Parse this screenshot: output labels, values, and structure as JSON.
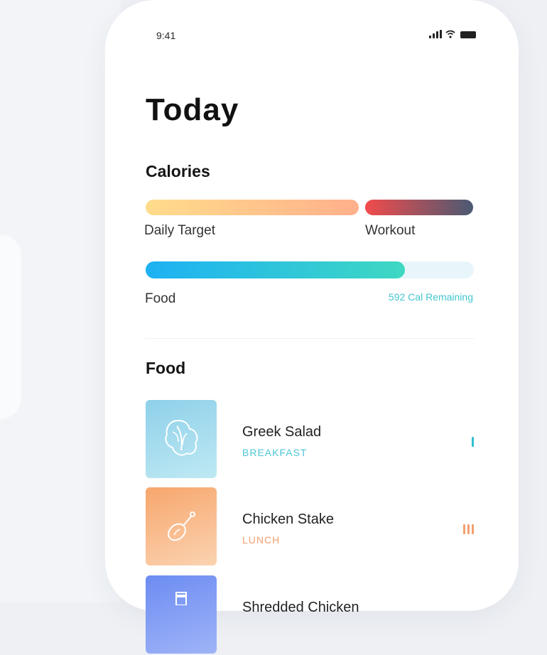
{
  "status_bar": {
    "time": "9:41",
    "icons": [
      "signal-icon",
      "wifi-icon",
      "battery-icon"
    ]
  },
  "page": {
    "title": "Today"
  },
  "calories": {
    "heading": "Calories",
    "daily_target_label": "Daily Target",
    "workout_label": "Workout",
    "food_label": "Food",
    "remaining_text": "592 Cal Remaining",
    "food_progress": 0.79
  },
  "food_section": {
    "heading": "Food",
    "items": [
      {
        "name": "Greek Salad",
        "meal": "BREAKFAST",
        "meal_color": "#4cc6d6",
        "icon": "lettuce-icon",
        "indicator_bars": 1,
        "indicator_color": "#30bfd0"
      },
      {
        "name": "Chicken Stake",
        "meal": "LUNCH",
        "meal_color": "#f3a070",
        "icon": "drumstick-icon",
        "indicator_bars": 3,
        "indicator_color": "#f3a070"
      },
      {
        "name": "Shredded Chicken",
        "meal": "",
        "meal_color": "#6f8ef5",
        "icon": "jar-icon",
        "indicator_bars": 0,
        "indicator_color": "#6f8ef5"
      }
    ]
  }
}
